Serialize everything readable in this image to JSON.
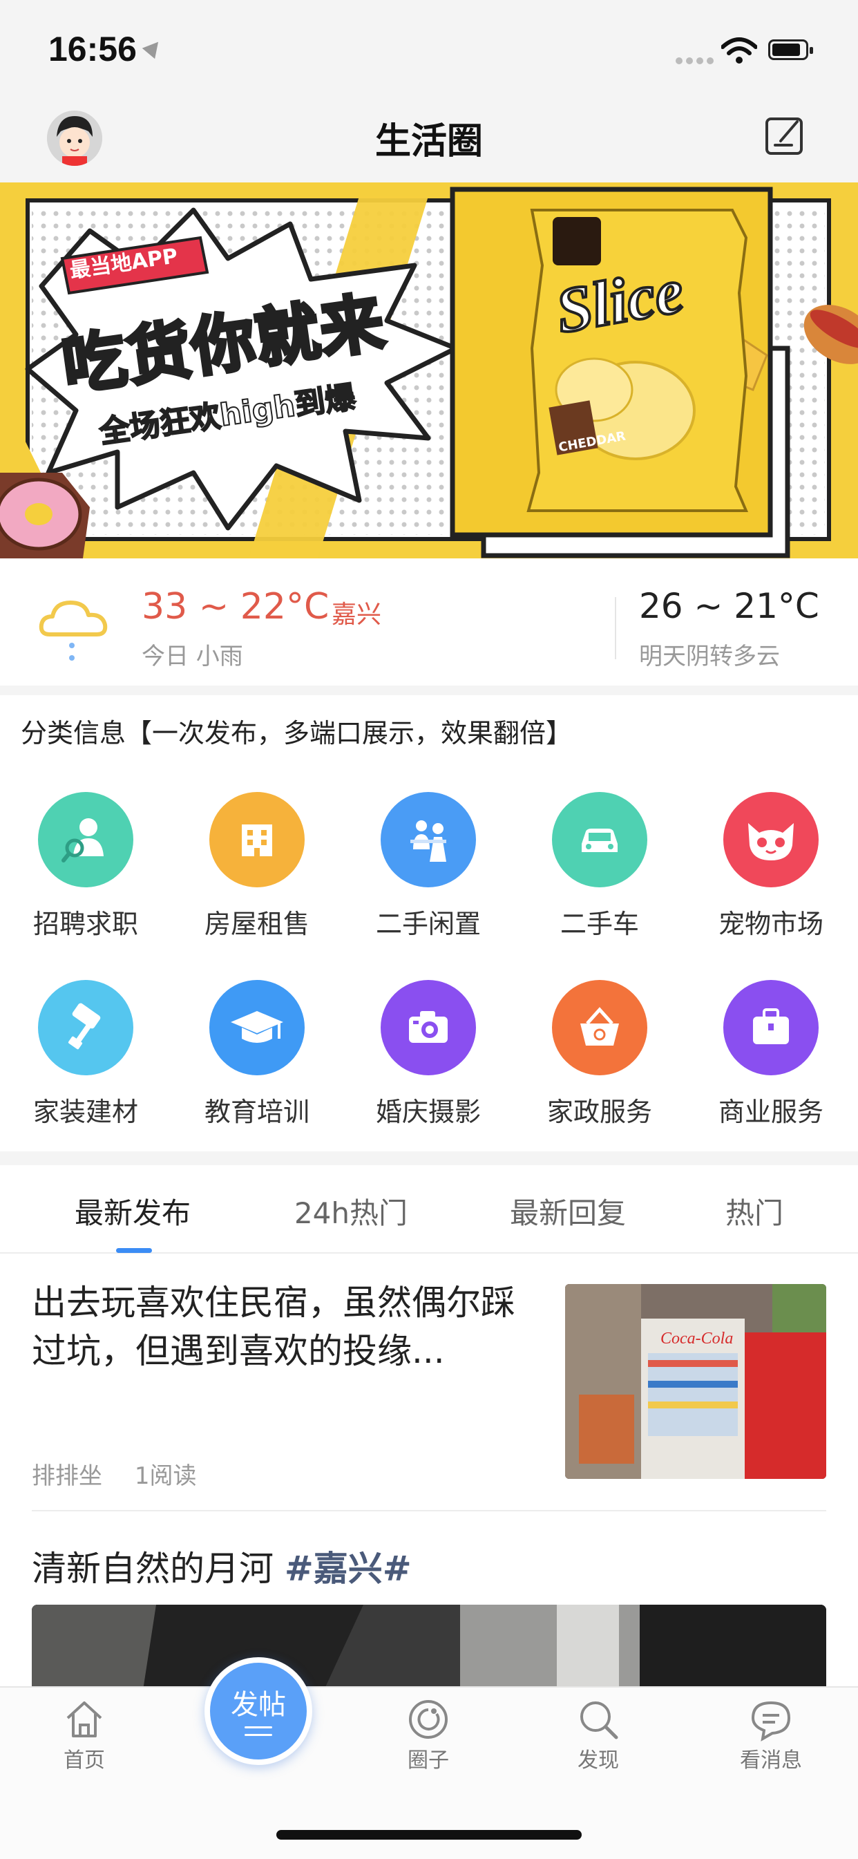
{
  "status_bar": {
    "time": "16:56"
  },
  "header": {
    "title": "生活圈"
  },
  "banner": {
    "badge": "最当地APP",
    "headline": "吃货你就来",
    "subline": "全场狂欢high到爆",
    "product_brand": "Slice",
    "product_flavor": "CHEDDAR",
    "background_color": "#f5cf3d"
  },
  "weather": {
    "today_temp": "33 ~ 22°C",
    "city": "嘉兴",
    "today_condition": "今日 小雨",
    "tomorrow_temp": "26 ~ 21°C",
    "tomorrow_condition": "明天阴转多云"
  },
  "categories": {
    "title": "分类信息【一次发布，多端口展示，效果翻倍】",
    "items": [
      {
        "label": "招聘求职",
        "icon": "job-search-icon",
        "color": "#4fd1b2"
      },
      {
        "label": "房屋租售",
        "icon": "building-icon",
        "color": "#f6b23b"
      },
      {
        "label": "二手闲置",
        "icon": "secondhand-trade-icon",
        "color": "#4a9cf5"
      },
      {
        "label": "二手车",
        "icon": "car-icon",
        "color": "#4fd1b2"
      },
      {
        "label": "宠物市场",
        "icon": "cat-icon",
        "color": "#f0485a"
      },
      {
        "label": "家装建材",
        "icon": "paint-roller-icon",
        "color": "#55c6ef"
      },
      {
        "label": "教育培训",
        "icon": "graduation-cap-icon",
        "color": "#3f9af5"
      },
      {
        "label": "婚庆摄影",
        "icon": "camera-icon",
        "color": "#8a4ff0"
      },
      {
        "label": "家政服务",
        "icon": "basket-icon",
        "color": "#f3733b"
      },
      {
        "label": "商业服务",
        "icon": "briefcase-icon",
        "color": "#8a4ff0"
      }
    ]
  },
  "tabs": [
    {
      "label": "最新发布",
      "active": true
    },
    {
      "label": "24h热门",
      "active": false
    },
    {
      "label": "最新回复",
      "active": false
    },
    {
      "label": "热门",
      "active": false
    }
  ],
  "feed": {
    "post1": {
      "title": "出去玩喜欢住民宿，虽然偶尔踩过坑，但遇到喜欢的投缘...",
      "author": "排排坐",
      "reads": "1阅读",
      "thumb_text": "Coca-Cola"
    },
    "post2": {
      "title": "清新自然的月河 ",
      "tag": "#嘉兴#"
    }
  },
  "tabbar": {
    "home": "首页",
    "post_button": "发帖",
    "circle": "圈子",
    "discover": "发现",
    "messages": "看消息"
  }
}
